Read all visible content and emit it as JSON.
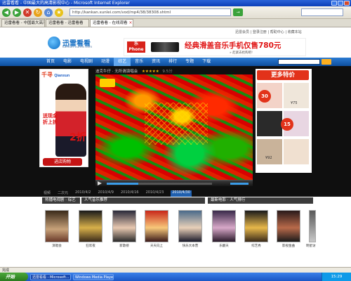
{
  "window": {
    "title": "迅雷看看 - 中国最大的高清影视中心 - Microsoft Internet Explorer"
  },
  "browser": {
    "address": "http://kankan.xunlei.com/vod/mp4/38/38308.shtml",
    "go_label": "→",
    "tabs": [
      {
        "label": "迅雷看看 - 中国最大高清..."
      },
      {
        "label": "迅雷看看 - 迅雷看看"
      },
      {
        "label": "迅雷看看 - 在线观看"
      }
    ]
  },
  "site": {
    "logo_name": "迅雷看看",
    "logo_sub": "kankan.xunlei.com",
    "top_links": "迅雷会员 | 登录注册 | 帮助中心 | 收藏本站",
    "ad": {
      "brand": "乐Phone",
      "headline": "经典滑盖音乐手机仅售780元",
      "hint": "» 赶紧去抢购吧!"
    },
    "nav": [
      "首页",
      "电影",
      "电视剧",
      "动漫",
      "综艺",
      "音乐",
      "资讯",
      "排行",
      "专题",
      "下载"
    ],
    "nav_current": 4,
    "player": {
      "title": "迪克牛仔 · 无所谓演唱会",
      "stars": "★★★★★",
      "rating": "9.5分"
    },
    "content_tabs": [
      "视频",
      "二次元",
      "2010/4/2",
      "2010/4/9",
      "2010/4/16",
      "2010/4/23",
      "2010/4/30"
    ],
    "content_tab_active": 6,
    "left_ad": {
      "brand": "千寻",
      "domain": "Qianxun",
      "line1": "送现金",
      "line2": "折上折",
      "big": "2折",
      "cta": "进店购物"
    },
    "right_ad": {
      "header": "更多特价",
      "price1": "30",
      "price2": "15",
      "small1": "¥75",
      "small2": "¥92"
    },
    "lists": [
      {
        "head": "热播电视剧 · 综艺"
      },
      {
        "head": "人气音乐推荐"
      },
      {
        "head": "最新电影 · 人气排行"
      }
    ],
    "posters": [
      {
        "caption": "演唱会"
      },
      {
        "caption": "狂欢夜"
      },
      {
        "caption": "新歌榜"
      },
      {
        "caption": "天天向上"
      },
      {
        "caption": "快乐大本营"
      },
      {
        "caption": "乐翻天"
      },
      {
        "caption": "综艺秀"
      },
      {
        "caption": "影视金曲"
      },
      {
        "caption": "明星访谈"
      }
    ]
  },
  "statusbar": "完成",
  "taskbar": {
    "start": "开始",
    "buttons": [
      "迅雷看看 - Microsoft...",
      "Windows Media Player"
    ],
    "clock": "15:29"
  }
}
